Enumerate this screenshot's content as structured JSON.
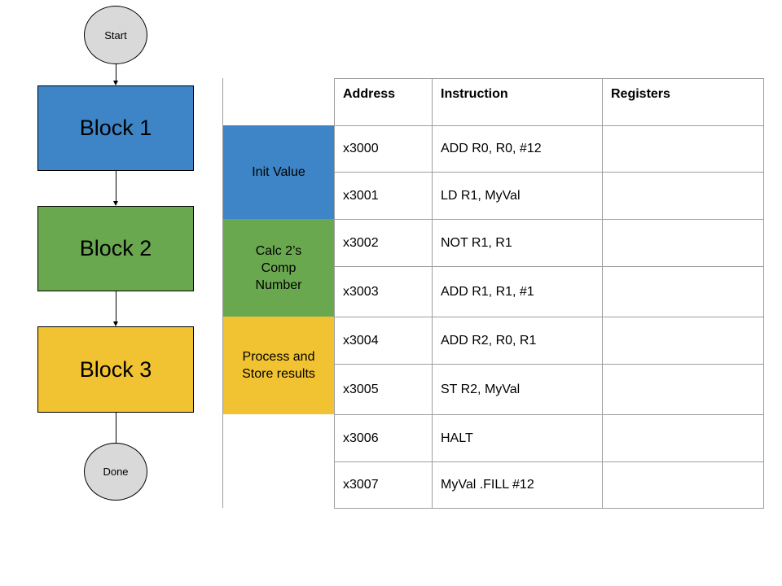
{
  "flowchart": {
    "start_label": "Start",
    "end_label": "Done",
    "blocks": [
      {
        "label": "Block 1",
        "color": "#3d85c6"
      },
      {
        "label": "Block 2",
        "color": "#6aa84f"
      },
      {
        "label": "Block 3",
        "color": "#f1c232"
      }
    ]
  },
  "sections": [
    {
      "label": "Init Value",
      "color": "#3d85c6"
    },
    {
      "label": "Calc 2’s Comp Number",
      "color": "#6aa84f"
    },
    {
      "label": "Process and Store results",
      "color": "#f1c232"
    }
  ],
  "table": {
    "headers": {
      "address": "Address",
      "instruction": "Instruction",
      "registers": "Registers"
    },
    "rows": [
      {
        "address": "x3000",
        "instruction": "ADD R0, R0, #12",
        "registers": ""
      },
      {
        "address": "x3001",
        "instruction": "LD R1, MyVal",
        "registers": ""
      },
      {
        "address": "x3002",
        "instruction": "NOT R1, R1",
        "registers": ""
      },
      {
        "address": "x3003",
        "instruction": "ADD R1, R1, #1",
        "registers": ""
      },
      {
        "address": "x3004",
        "instruction": "ADD R2, R0, R1",
        "registers": ""
      },
      {
        "address": "x3005",
        "instruction": "ST R2, MyVal",
        "registers": ""
      },
      {
        "address": "x3006",
        "instruction": "HALT",
        "registers": ""
      },
      {
        "address": "x3007",
        "instruction": "MyVal .FILL #12",
        "registers": ""
      }
    ]
  }
}
